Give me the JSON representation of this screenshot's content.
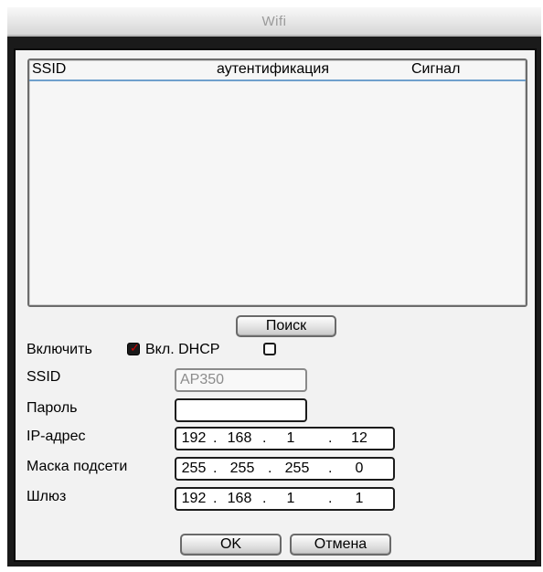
{
  "window": {
    "title": "Wifi"
  },
  "network_list": {
    "columns": [
      "SSID",
      "аутентификация",
      "Сигнал"
    ],
    "rows": []
  },
  "search_button": "Поиск",
  "enable": {
    "label": "Включить",
    "checked": true
  },
  "dhcp": {
    "label": "Вкл. DHCP",
    "checked": false
  },
  "fields": {
    "ssid": {
      "label": "SSID",
      "value": "AP350"
    },
    "password": {
      "label": "Пароль",
      "value": ""
    },
    "ip_address": {
      "label": "IP-адрес",
      "octets": [
        "192",
        "168",
        "1",
        "12"
      ]
    },
    "subnet_mask": {
      "label": "Маска подсети",
      "octets": [
        "255",
        "255",
        "255",
        "0"
      ]
    },
    "gateway": {
      "label": "Шлюз",
      "octets": [
        "192",
        "168",
        "1",
        "1"
      ]
    }
  },
  "buttons": {
    "ok": "OK",
    "cancel": "Отмена"
  },
  "colors": {
    "frame": "#1a1a1a",
    "panel": "#f2f2f2",
    "header_line": "#6fa0cc",
    "checkmark": "#d40000"
  }
}
